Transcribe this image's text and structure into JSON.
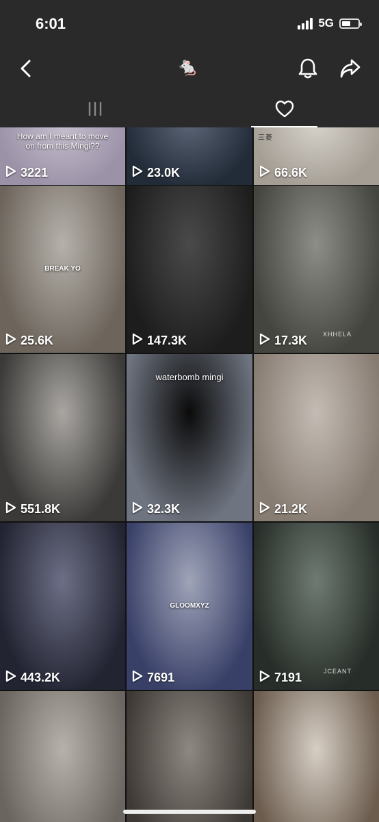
{
  "status": {
    "time": "6:01",
    "network": "5G",
    "battery_level": 0.55
  },
  "header": {
    "emoji": "🐁",
    "icons": {
      "back": "chevron-left-icon",
      "bell": "bell-icon",
      "share": "share-arrow-icon"
    }
  },
  "tabs": [
    {
      "name": "videos",
      "icon": "grid-icon",
      "active": false
    },
    {
      "name": "liked",
      "icon": "heart-outline-icon",
      "active": true
    }
  ],
  "tiles": [
    {
      "views": "3221",
      "caption": "How am I meant to move\non from this Mingi??",
      "colors": [
        "#c7c1cf",
        "#9c92a8"
      ]
    },
    {
      "views": "23.0K",
      "colors": [
        "#5d6677",
        "#222b38"
      ]
    },
    {
      "views": "66.6K",
      "watermark_top": "三菱",
      "colors": [
        "#d9d4cc",
        "#a49e95"
      ]
    },
    {
      "views": "25.6K",
      "overlay": "BREAK YO",
      "colors": [
        "#b5b1ab",
        "#6d655c"
      ]
    },
    {
      "views": "147.3K",
      "colors": [
        "#4a4a4a",
        "#1d1d1d"
      ]
    },
    {
      "views": "17.3K",
      "watermark": "XHHELA",
      "colors": [
        "#8d8e87",
        "#44453f"
      ]
    },
    {
      "views": "551.8K",
      "colors": [
        "#a9a6a2",
        "#3b3a38"
      ]
    },
    {
      "views": "32.3K",
      "title": "waterbomb mingi",
      "colors": [
        "#0b0b0b",
        "#6e7480"
      ]
    },
    {
      "views": "21.2K",
      "colors": [
        "#c4bcb4",
        "#877c72"
      ]
    },
    {
      "views": "443.2K",
      "colors": [
        "#6c6f86",
        "#232432"
      ]
    },
    {
      "views": "7691",
      "overlay": "GLOOMXYZ",
      "colors": [
        "#9fa4b8",
        "#394068"
      ]
    },
    {
      "views": "7191",
      "watermark": "JCEANT",
      "colors": [
        "#6f7b72",
        "#272d28"
      ]
    },
    {
      "views": "",
      "colors": [
        "#b6b2ab",
        "#6b6560"
      ]
    },
    {
      "views": "",
      "colors": [
        "#8d8882",
        "#3e3934"
      ]
    },
    {
      "views": "",
      "colors": [
        "#d6cec4",
        "#6b5c4e"
      ]
    }
  ]
}
